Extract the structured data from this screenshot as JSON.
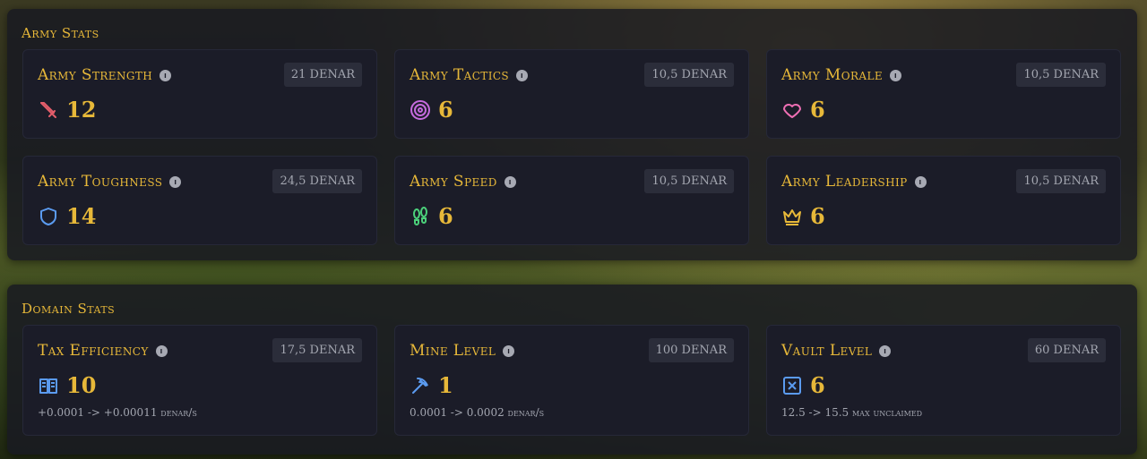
{
  "army": {
    "title": "Army Stats",
    "cards": [
      {
        "label": "Army Strength",
        "cost": "21 DENAR",
        "value": "12",
        "icon": "sword-icon",
        "color": "#e35d6a"
      },
      {
        "label": "Army Tactics",
        "cost": "10,5 DENAR",
        "value": "6",
        "icon": "target-icon",
        "color": "#c56bde"
      },
      {
        "label": "Army Morale",
        "cost": "10,5 DENAR",
        "value": "6",
        "icon": "heart-icon",
        "color": "#ef6fb4"
      },
      {
        "label": "Army Toughness",
        "cost": "24,5 DENAR",
        "value": "14",
        "icon": "shield-icon",
        "color": "#5b9bf0"
      },
      {
        "label": "Army Speed",
        "cost": "10,5 DENAR",
        "value": "6",
        "icon": "footprints-icon",
        "color": "#4bd07a"
      },
      {
        "label": "Army Leadership",
        "cost": "10,5 DENAR",
        "value": "6",
        "icon": "crown-icon",
        "color": "#e7b839"
      }
    ]
  },
  "domain": {
    "title": "Domain Stats",
    "cards": [
      {
        "label": "Tax Efficiency",
        "cost": "17,5 DENAR",
        "value": "10",
        "icon": "book-icon",
        "color": "#5b9bf0",
        "sub": "+0.0001 -> +0.00011 denar/s"
      },
      {
        "label": "Mine Level",
        "cost": "100 DENAR",
        "value": "1",
        "icon": "pickaxe-icon",
        "color": "#5b9bf0",
        "sub": "0.0001 -> 0.0002 denar/s"
      },
      {
        "label": "Vault Level",
        "cost": "60 DENAR",
        "value": "6",
        "icon": "vault-icon",
        "color": "#5b9bf0",
        "sub": "12.5 -> 15.5 max unclaimed"
      }
    ]
  }
}
